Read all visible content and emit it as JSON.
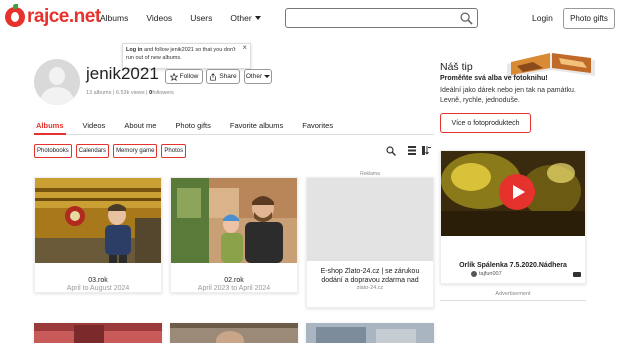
{
  "brand": {
    "name": "rajce.net",
    "accent": "#e5322d"
  },
  "nav": {
    "albums": "Albums",
    "videos": "Videos",
    "users": "Users",
    "other": "Other"
  },
  "search": {
    "placeholder": ""
  },
  "header": {
    "login": "Login",
    "photo_gifts": "Photo gifts"
  },
  "tooltip": {
    "bold": "Log in",
    "text": " and follow jenik2021 so that you don't run out of new albums."
  },
  "profile": {
    "username": "jenik2021",
    "albums": "13 albums",
    "views": "6.53k views",
    "followers_count": "0",
    "followers_label": "followers",
    "follow": "Follow",
    "share": "Share",
    "other": "Other"
  },
  "tabs": [
    "Albums",
    "Videos",
    "About me",
    "Photo gifts",
    "Favorite albums",
    "Favorites"
  ],
  "filters": [
    "Photobooks",
    "Calendars",
    "Memory game",
    "Photos"
  ],
  "albums": [
    {
      "title": "03.rok",
      "dates": "April to August 2024"
    },
    {
      "title": "02.rok",
      "dates": "April 2023 to April 2024"
    }
  ],
  "ad": {
    "label": "Reklama",
    "title": "E-shop Zlato-24.cz | se zárukou dodání a dopravou zdarma nad",
    "source": "zlato-24.cz"
  },
  "sidebar": {
    "tip_title": "Náš tip",
    "tip_lead": "Proměňte svá alba ve fotoknihu!",
    "tip_text": "Ideální jako dárek nebo jen tak na památku. Levně, rychle, jednoduše.",
    "tip_button": "Více o fotoproduktech",
    "video_title": "Orlík Spálenka 7.5.2020.Nádhera",
    "video_user": "tajfun007",
    "advertisement": "Advertisement"
  }
}
